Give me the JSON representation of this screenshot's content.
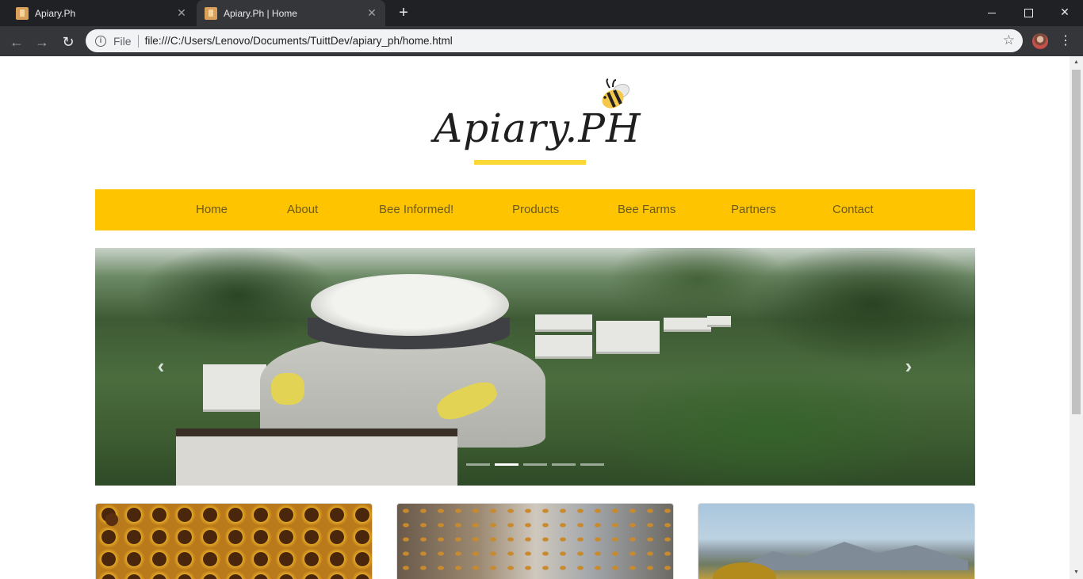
{
  "browser": {
    "tabs": [
      {
        "title": "Apiary.Ph",
        "active": false
      },
      {
        "title": "Apiary.Ph | Home",
        "active": true
      }
    ],
    "new_tab_icon": "+",
    "address": {
      "scheme_label": "File",
      "url": "file:///C:/Users/Lenovo/Documents/TuittDev/apiary_ph/home.html"
    }
  },
  "site": {
    "logo_text": "Apiary.PH",
    "brand_color": "#fec400",
    "nav": [
      {
        "label": "Home"
      },
      {
        "label": "About"
      },
      {
        "label": "Bee Informed!"
      },
      {
        "label": "Products"
      },
      {
        "label": "Bee Farms"
      },
      {
        "label": "Partners"
      },
      {
        "label": "Contact"
      }
    ],
    "carousel": {
      "slide_count": 5,
      "active_index": 1
    },
    "cards": [
      {
        "image": "honeycomb"
      },
      {
        "image": "bees-on-hives"
      },
      {
        "image": "bees-over-mountains"
      }
    ]
  }
}
